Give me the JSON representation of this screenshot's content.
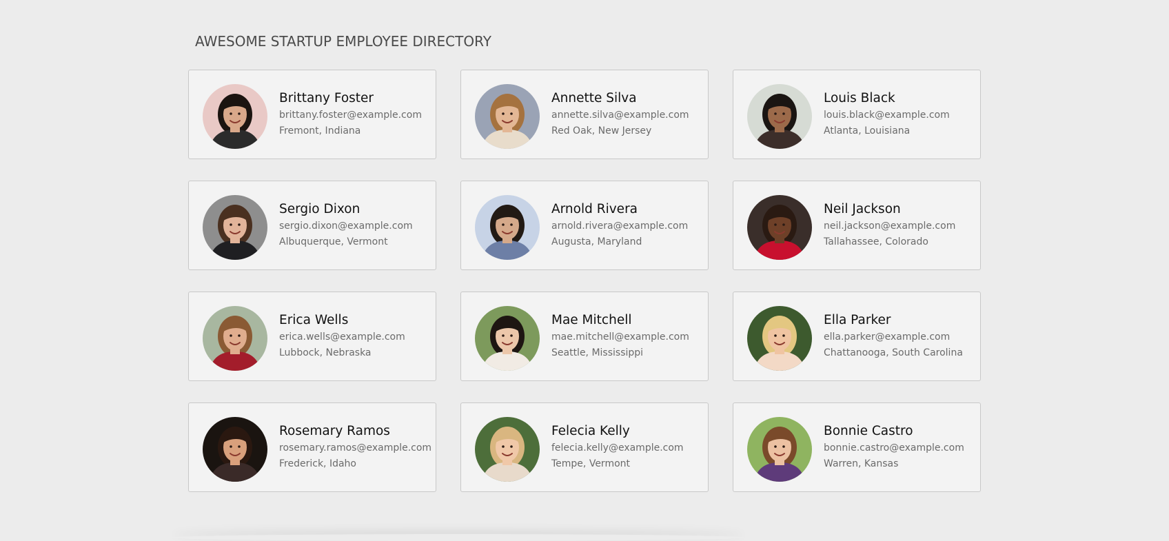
{
  "header": {
    "title": "AWESOME STARTUP EMPLOYEE DIRECTORY"
  },
  "employees": [
    {
      "name": "Brittany Foster",
      "email": "brittany.foster@example.com",
      "location": "Fremont, Indiana",
      "bg": "#e9c9c6",
      "skin": "#d9a88a",
      "hair": "#1b1410",
      "shirt": "#2b2b2b"
    },
    {
      "name": "Annette Silva",
      "email": "annette.silva@example.com",
      "location": "Red Oak, New Jersey",
      "bg": "#9aa3b5",
      "skin": "#e3b795",
      "hair": "#a5723f",
      "shirt": "#e8dccb"
    },
    {
      "name": "Louis Black",
      "email": "louis.black@example.com",
      "location": "Atlanta, Louisiana",
      "bg": "#d6dbd4",
      "skin": "#9c6a4a",
      "hair": "#1a1512",
      "shirt": "#3c2e2a"
    },
    {
      "name": "Sergio Dixon",
      "email": "sergio.dixon@example.com",
      "location": "Albuquerque, Vermont",
      "bg": "#8e8e8e",
      "skin": "#e2b49a",
      "hair": "#4a3020",
      "shirt": "#1f1f22"
    },
    {
      "name": "Arnold Rivera",
      "email": "arnold.rivera@example.com",
      "location": "Augusta, Maryland",
      "bg": "#c7d3e6",
      "skin": "#d5a98a",
      "hair": "#221a14",
      "shirt": "#6d7fa6"
    },
    {
      "name": "Neil Jackson",
      "email": "neil.jackson@example.com",
      "location": "Tallahassee, Colorado",
      "bg": "#3a2e2a",
      "skin": "#6e4028",
      "hair": "#2a1a12",
      "shirt": "#c8102e"
    },
    {
      "name": "Erica Wells",
      "email": "erica.wells@example.com",
      "location": "Lubbock, Nebraska",
      "bg": "#a8b7a0",
      "skin": "#e0ad8e",
      "hair": "#8a5a34",
      "shirt": "#a31d2b"
    },
    {
      "name": "Mae Mitchell",
      "email": "mae.mitchell@example.com",
      "location": "Seattle, Mississippi",
      "bg": "#7d9a5c",
      "skin": "#ecc7aa",
      "hair": "#1e1612",
      "shirt": "#f1ebe4"
    },
    {
      "name": "Ella Parker",
      "email": "ella.parker@example.com",
      "location": "Chattanooga, South Carolina",
      "bg": "#3d5a2e",
      "skin": "#f0c4a2",
      "hair": "#e3c781",
      "shirt": "#f3d9c6"
    },
    {
      "name": "Rosemary Ramos",
      "email": "rosemary.ramos@example.com",
      "location": "Frederick, Idaho",
      "bg": "#1a1410",
      "skin": "#d9a07c",
      "hair": "#2a1810",
      "shirt": "#3a2a28"
    },
    {
      "name": "Felecia Kelly",
      "email": "felecia.kelly@example.com",
      "location": "Tempe, Vermont",
      "bg": "#4d6e3a",
      "skin": "#f0c8a8",
      "hair": "#d9b680",
      "shirt": "#e8dacb"
    },
    {
      "name": "Bonnie Castro",
      "email": "bonnie.castro@example.com",
      "location": "Warren, Kansas",
      "bg": "#8fb460",
      "skin": "#ecc1a2",
      "hair": "#7a4a2a",
      "shirt": "#5e3b7a"
    }
  ]
}
